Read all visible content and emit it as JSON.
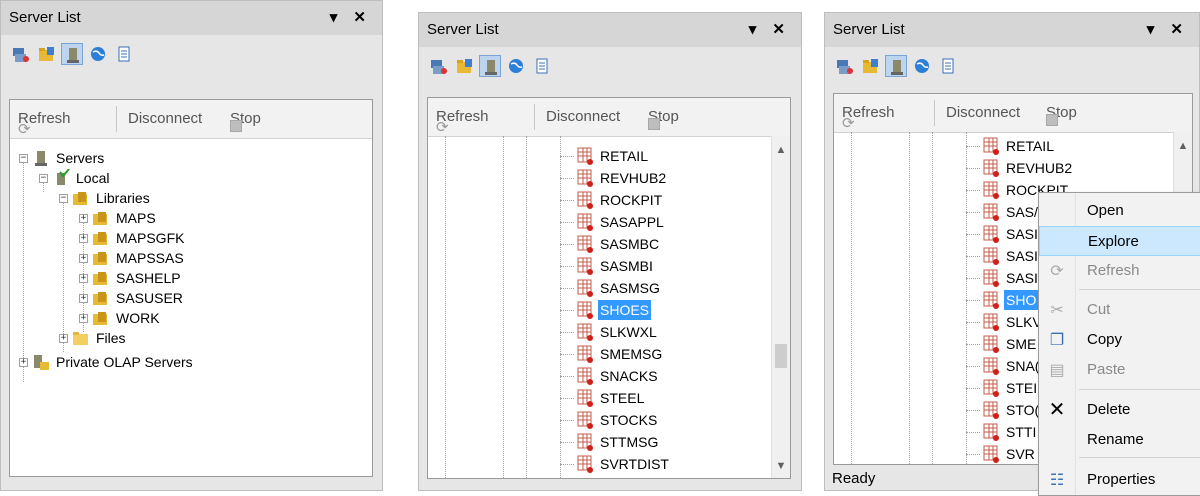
{
  "panel_title": "Server List",
  "panel_controls": "▾ ✕",
  "toolbar": {
    "refresh": "Refresh",
    "disconnect": "Disconnect",
    "stop": "Stop"
  },
  "iconbar": [
    "servers-view-icon",
    "libraries-view-icon",
    "server-selected-icon",
    "globe-icon",
    "document-icon"
  ],
  "tree1": {
    "servers": "Servers",
    "local": "Local",
    "libraries": "Libraries",
    "libs": [
      "MAPS",
      "MAPSGFK",
      "MAPSSAS",
      "SASHELP",
      "SASUSER",
      "WORK"
    ],
    "files": "Files",
    "olap": "Private OLAP Servers"
  },
  "tree2": [
    "RETAIL",
    "REVHUB2",
    "ROCKPIT",
    "SASAPPL",
    "SASMBC",
    "SASMBI",
    "SASMSG",
    "SHOES",
    "SLKWXL",
    "SMEMSG",
    "SNACKS",
    "STEEL",
    "STOCKS",
    "STTMSG",
    "SVRTDIST"
  ],
  "tree3": [
    "RETAIL",
    "REVHUB2",
    "ROCKPIT",
    "SAS/",
    "SASI",
    "SASI",
    "SASI",
    "SHO",
    "SLKV",
    "SME",
    "SNA(",
    "STEI",
    "STO(",
    "STTI",
    "SVR"
  ],
  "context_menu": {
    "open": "Open",
    "explore": "Explore",
    "refresh": "Refresh",
    "cut": "Cut",
    "copy": "Copy",
    "paste": "Paste",
    "delete": "Delete",
    "rename": "Rename",
    "properties": "Properties"
  },
  "status": "Ready",
  "selected_table": "SHOES",
  "colors": {
    "selection": "#3399ff",
    "menu_hover": "#cce8ff"
  }
}
